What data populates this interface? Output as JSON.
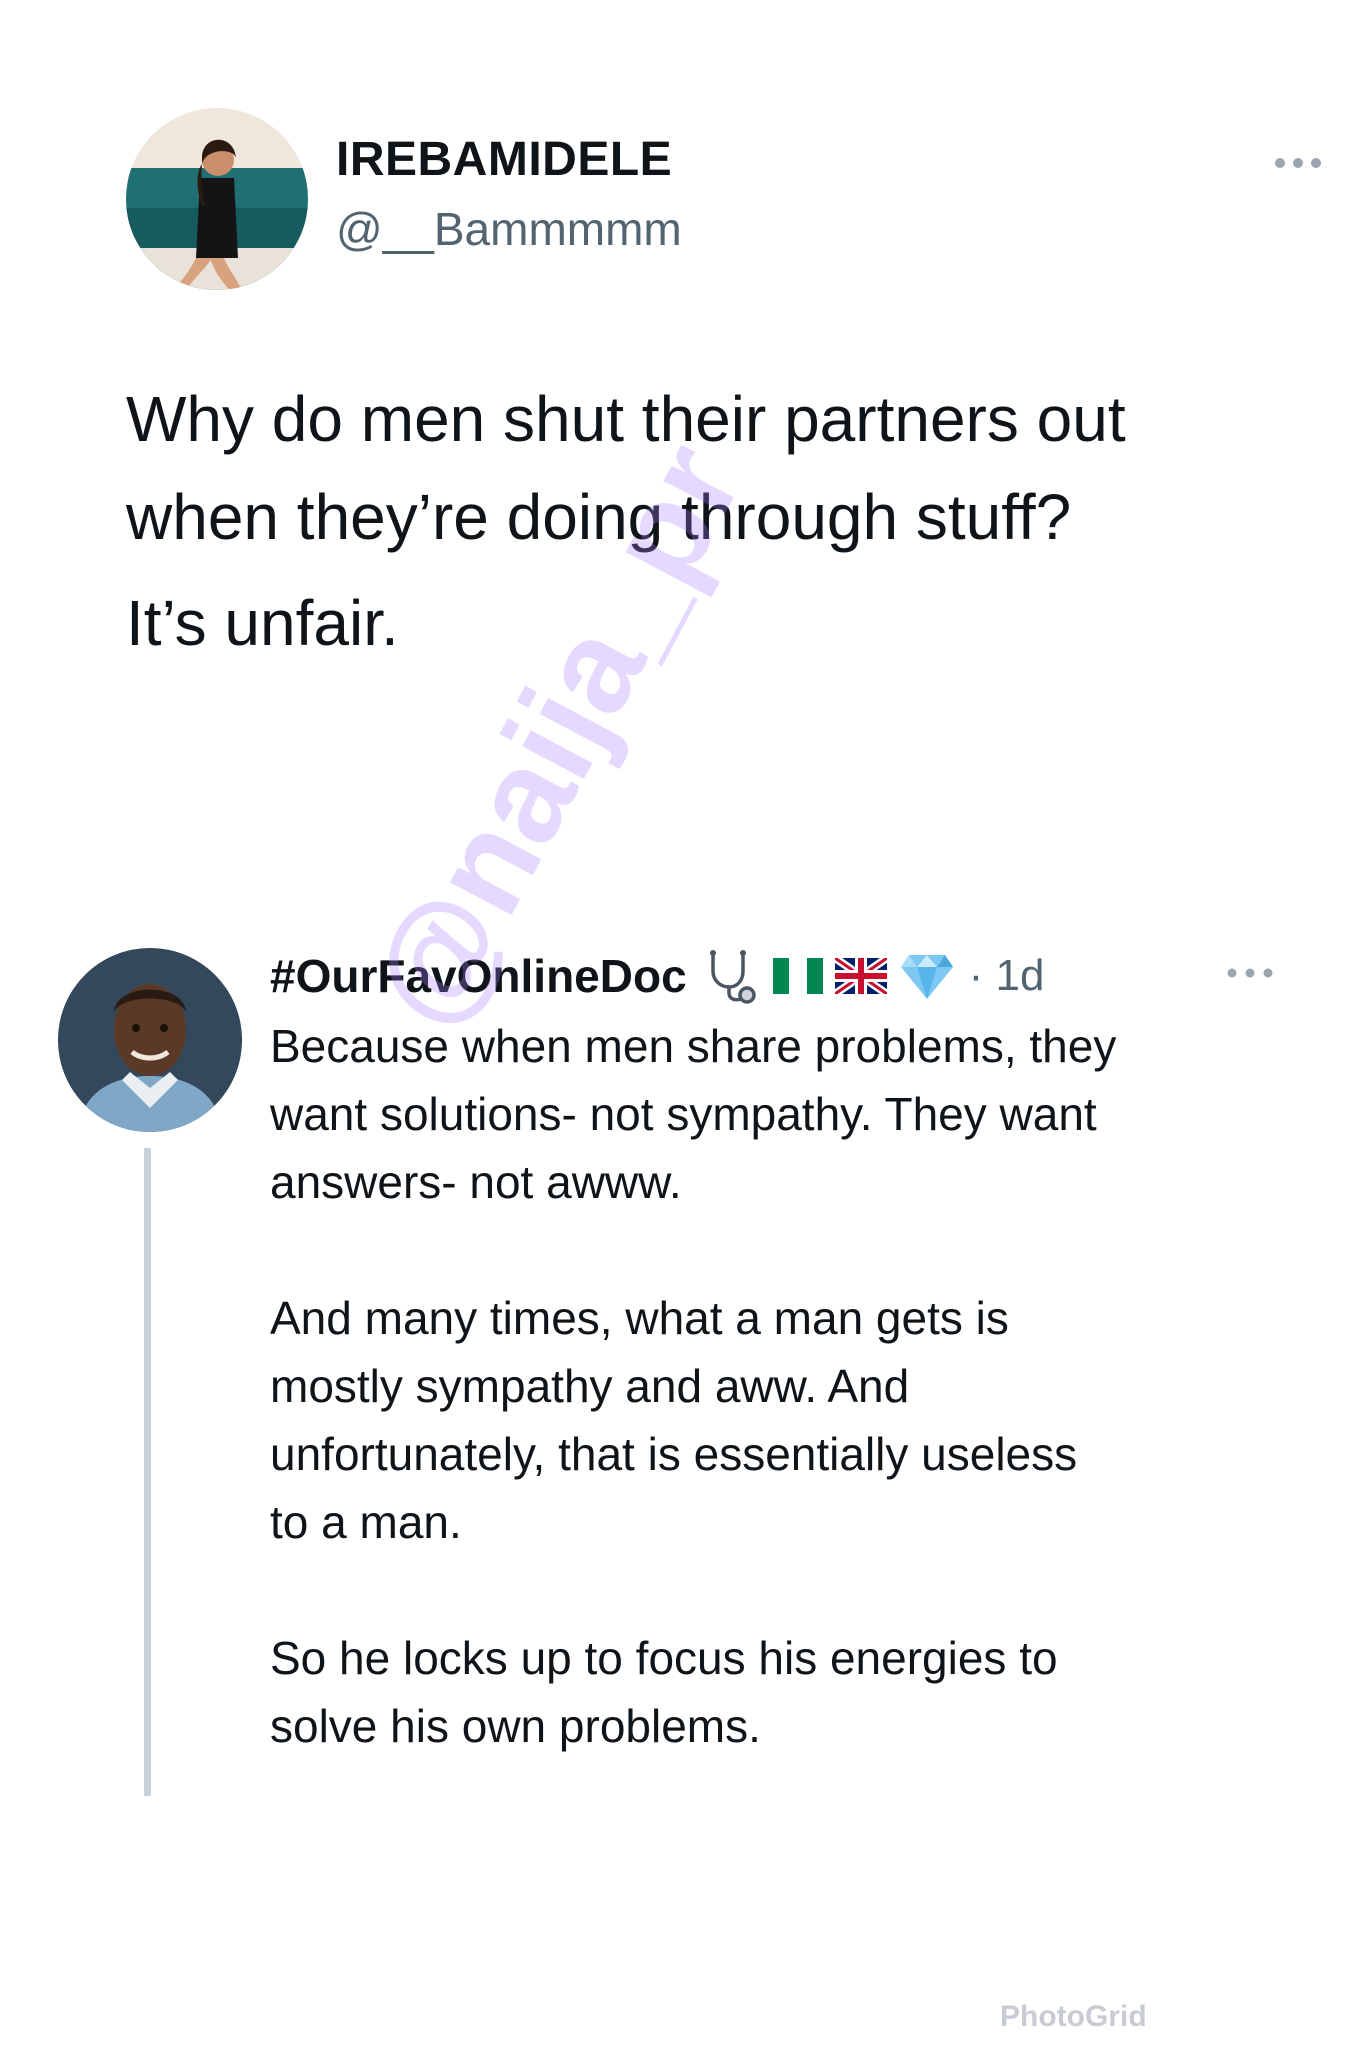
{
  "original_tweet": {
    "author_name": "IREBAMIDELE",
    "author_handle": "@__Bammmmm",
    "text_lines": [
      "Why do men shut their partners out",
      "when they’re doing through stuff?",
      "It’s unfair."
    ]
  },
  "reply": {
    "author_name": "#OurFavOnlineDoc",
    "name_emojis": [
      "stethoscope-icon",
      "nigeria-flag-icon",
      "uk-flag-icon",
      "gem-icon"
    ],
    "time": "· 1d",
    "paragraphs": [
      "Because when men share problems, they\nwant solutions- not sympathy. They want\nanswers- not awww.",
      "And many times, what a man gets is\nmostly sympathy and aww. And\nunfortunately, that is essentially useless\nto a man.",
      "So he locks up to focus his energies to\nsolve his own problems."
    ]
  },
  "watermark": "@naija_pr",
  "app_watermark": "PhotoGrid",
  "colors": {
    "text": "#0f1419",
    "secondary_text": "#536471",
    "thread_line": "#c9d1d8",
    "watermark": "#aa82ff"
  }
}
